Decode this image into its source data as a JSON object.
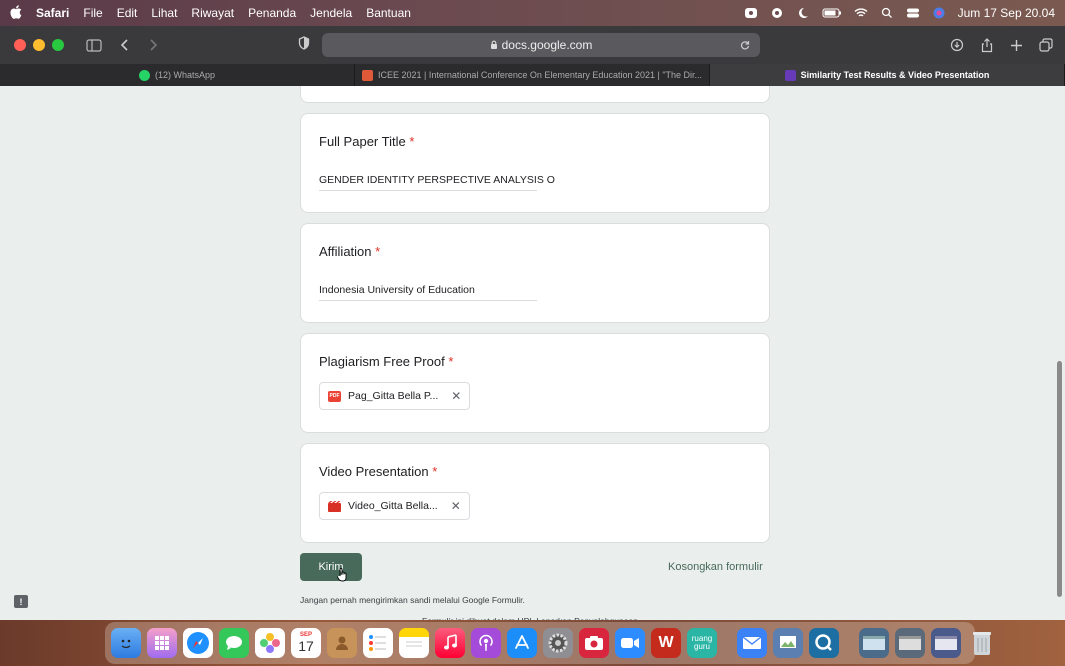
{
  "menubar": {
    "apple": "",
    "items": [
      "Safari",
      "File",
      "Edit",
      "Lihat",
      "Riwayat",
      "Penanda",
      "Jendela",
      "Bantuan"
    ],
    "datetime": "Jum 17 Sep 20.04"
  },
  "toolbar": {
    "url": "docs.google.com"
  },
  "tabs": [
    {
      "label": "(12) WhatsApp",
      "icon": "whatsapp-icon",
      "color": "#25d366"
    },
    {
      "label": "ICEE 2021 | International Conference On Elementary Education 2021 | \"The Dir...",
      "icon": "icee-icon",
      "color": "#e05a3a"
    },
    {
      "label": "Similarity Test Results & Video Presentation",
      "icon": "forms-icon",
      "color": "#673ab7"
    }
  ],
  "form": {
    "q1": {
      "title": "Full Paper Title",
      "required": "*",
      "answer": "GENDER IDENTITY PERSPECTIVE ANALYSIS O"
    },
    "q2": {
      "title": "Affiliation",
      "required": "*",
      "answer": "Indonesia University of Education"
    },
    "q3": {
      "title": "Plagiarism Free Proof",
      "required": "*",
      "file": "Pag_Gitta Bella P...",
      "file_icon_text": "PDF"
    },
    "q4": {
      "title": "Video Presentation",
      "required": "*",
      "file": "Video_Gitta Bella..."
    },
    "submit_label": "Kirim",
    "clear_label": "Kosongkan formulir",
    "never_text": "Jangan pernah mengirimkan sandi melalui Google Formulir.",
    "footer_text": "Formulir ini dibuat dalam UPI. Laporkan Penyalahgunaan",
    "close_glyph": "✕",
    "feedback_glyph": "!"
  },
  "colors": {
    "accent": "#486a5b",
    "required": "#d93025"
  },
  "dock": {
    "calendar_month": "SEP",
    "calendar_day": "17",
    "word_letter": "W",
    "ruangguru_label": "ruang guru"
  }
}
